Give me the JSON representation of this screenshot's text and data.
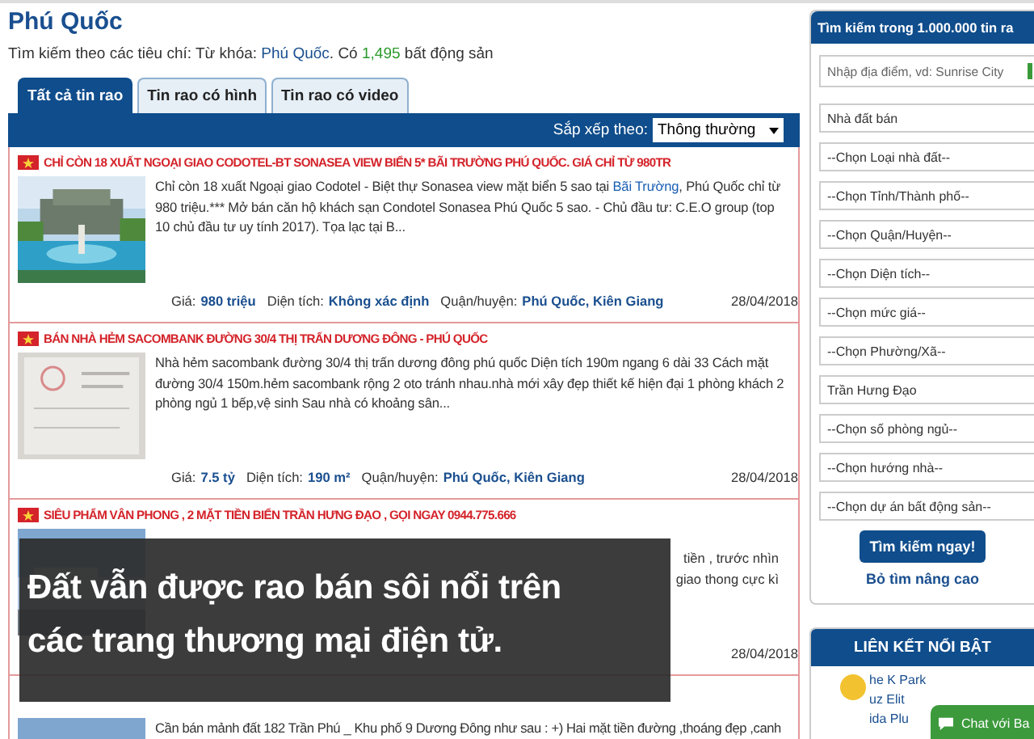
{
  "page_title": "Phú Quốc",
  "summary": "Tìm kiếm theo các tiêu chí: Từ khóa: **Phú Quốc**. Có **1,495** bất động sản",
  "tabs": [
    {
      "label": "Tất cả tin rao",
      "selected": true
    },
    {
      "label": "Tin rao có hình",
      "selected": false
    },
    {
      "label": "Tin rao có video",
      "selected": false
    }
  ],
  "sort": {
    "label": "Sắp xếp theo:",
    "value": "Thông thường"
  },
  "listings": [
    {
      "title": "CHỈ CÒN 18 XUẤT NGOẠI GIAO CODOTEL-BT SONASEA VIEW BIỂN 5* BÃI TRƯỜNG PHÚ QUỐC. GIÁ CHỈ TỪ 980TR",
      "body_parts": [
        {
          "kind": "text",
          "text": "Chỉ còn 18 xuất Ngoại giao Codotel - Biệt thự Sonasea view mặt biển 5 sao tại "
        },
        {
          "kind": "link",
          "text": "Bãi Trường"
        },
        {
          "kind": "text",
          "text": ", Phú Quốc chỉ từ 980 triệu.*** Mở bán căn hộ khách sạn Condotel Sonasea Phú Quốc 5 sao. - Chủ đầu tư: C.E.O group (top 10 chủ đầu tư uy tính 2017). Tọa lạc tại B..."
        }
      ],
      "facts": [
        {
          "label": "Giá:",
          "value": "980 triệu"
        },
        {
          "label": "Diện tích:",
          "value": "Không xác định"
        },
        {
          "label": "Quận/huyện:",
          "value": "Phú Quốc, Kiên Giang"
        }
      ],
      "date": "28/04/2018"
    },
    {
      "title": "BÁN NHÀ HẺM SACOMBANK ĐƯỜNG 30/4 THỊ TRẤN DƯƠNG ĐÔNG - PHÚ QUỐC",
      "body": "Nhà hẻm sacombank đường 30/4 thị trấn dương đông phú quốc Diện tích 190m ngang 6 dài 33 Cách mặt đường 30/4 150m.hẻm sacombank rộng 2 oto tránh nhau.nhà mới xây đẹp thiết kế hiện đại 1 phòng khách 2 phòng ngủ 1 bếp,vệ sinh Sau nhà có khoảng sân...",
      "facts": [
        {
          "label": "Giá:",
          "value": "7.5 tỷ"
        },
        {
          "label": "Diện tích:",
          "value": "190 m²"
        },
        {
          "label": "Quận/huyện:",
          "value": "Phú Quốc, Kiên Giang"
        }
      ],
      "date": "28/04/2018"
    },
    {
      "title": "SIÊU PHẨM VÂN PHONG , 2 MẶT TIỀN BIỂN TRẦN HƯNG ĐẠO , GỌI NGAY 0944.775.666",
      "body_fragments": [
        "tiền , trước nhìn",
        "giao thong cực kì"
      ],
      "date": "28/04/2018"
    },
    {
      "body": "Cần bán mảnh đất 182 Trần Phú _ Khu phố 9 Dương Đông như sau : +) Hai mặt tiền đường ,thoáng đẹp ,canh"
    }
  ],
  "search_panel": {
    "title": "Tìm kiếm trong 1.000.000 tin ra",
    "fields": [
      {
        "kind": "input",
        "placeholder": "Nhập địa điểm, vd: Sunrise City"
      },
      {
        "kind": "select",
        "value": "Nhà đất bán"
      },
      {
        "kind": "select",
        "value": "--Chọn Loại nhà đất--"
      },
      {
        "kind": "select",
        "value": "--Chọn Tỉnh/Thành phố--"
      },
      {
        "kind": "select",
        "value": "--Chọn Quận/Huyện--"
      },
      {
        "kind": "select",
        "value": "--Chọn Diện tích--"
      },
      {
        "kind": "select",
        "value": "--Chọn mức giá--"
      },
      {
        "kind": "select",
        "value": "--Chọn Phường/Xã--"
      },
      {
        "kind": "input",
        "value": "Trần Hưng Đạo"
      },
      {
        "kind": "select",
        "value": "--Chọn số phòng ngủ--"
      },
      {
        "kind": "select",
        "value": "--Chọn hướng nhà--"
      },
      {
        "kind": "select",
        "value": "--Chọn dự án bất động sản--"
      }
    ],
    "button": "Tìm kiếm ngay!",
    "link": "Bỏ tìm nâng cao"
  },
  "featured_links": {
    "title": "LIÊN KẾT NỔI BẬT",
    "items": [
      "he K Park",
      "uz Elit",
      "ida Plu"
    ]
  },
  "chat_button": "Chat với Ba",
  "caption": "Đất vẫn được rao bán sôi nổi trên các trang thương mại điện tử."
}
